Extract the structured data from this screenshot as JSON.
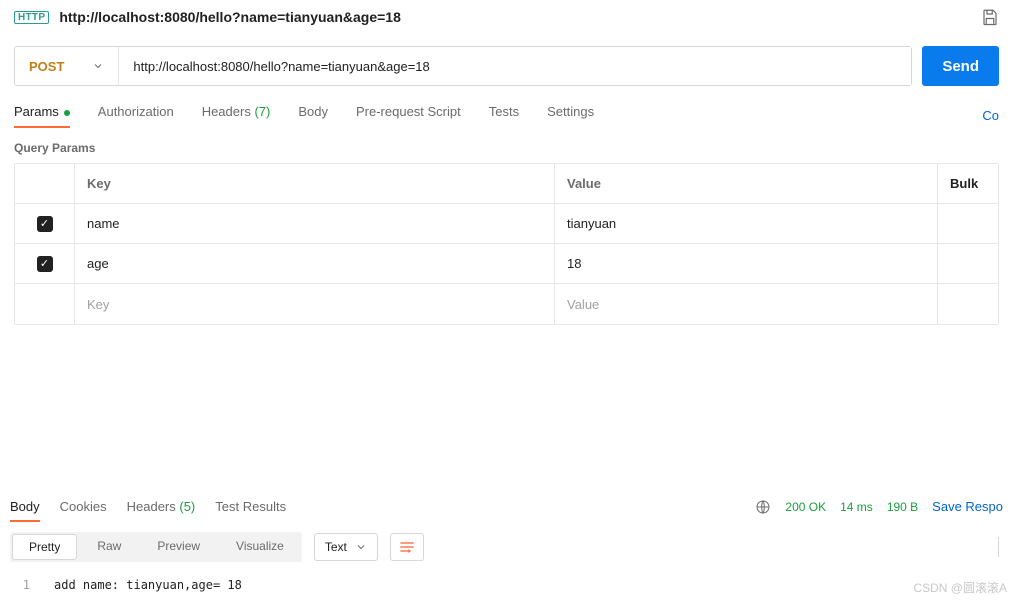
{
  "topbar": {
    "http_badge": "HTTP",
    "url": "http://localhost:8080/hello?name=tianyuan&age=18"
  },
  "request": {
    "method": "POST",
    "url": "http://localhost:8080/hello?name=tianyuan&age=18",
    "send_label": "Send"
  },
  "tabs": {
    "params": "Params",
    "authorization": "Authorization",
    "headers": "Headers",
    "headers_count": "(7)",
    "body": "Body",
    "prerequest": "Pre-request Script",
    "tests": "Tests",
    "settings": "Settings",
    "right_action": "Co"
  },
  "query_params": {
    "section_label": "Query Params",
    "header_key": "Key",
    "header_value": "Value",
    "bulk_label": "Bulk",
    "rows": [
      {
        "checked": true,
        "key": "name",
        "value": "tianyuan"
      },
      {
        "checked": true,
        "key": "age",
        "value": "18"
      }
    ],
    "placeholder_key": "Key",
    "placeholder_value": "Value"
  },
  "response": {
    "tabs": {
      "body": "Body",
      "cookies": "Cookies",
      "headers": "Headers",
      "headers_count": "(5)",
      "test_results": "Test Results"
    },
    "meta": {
      "status": "200 OK",
      "time": "14 ms",
      "size": "190 B",
      "save_label": "Save Respo"
    },
    "toolbar": {
      "pretty": "Pretty",
      "raw": "Raw",
      "preview": "Preview",
      "visualize": "Visualize",
      "format": "Text"
    },
    "body_lines": [
      {
        "n": "1",
        "text": "add name: tianyuan,age= 18"
      }
    ]
  },
  "watermark": "CSDN @圆滚滚A"
}
